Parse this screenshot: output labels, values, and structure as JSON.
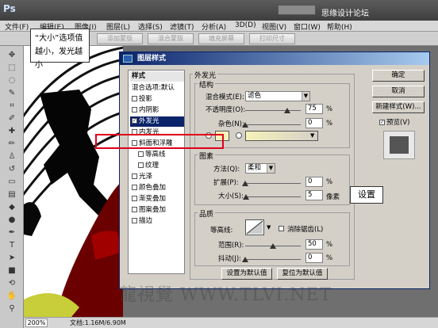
{
  "app": {
    "logo": "Ps"
  },
  "site_badge": "思缘设计论坛",
  "menu": [
    "文件(F)",
    "编辑(E)",
    "图像(I)",
    "图层(L)",
    "选择(S)",
    "滤镜(T)",
    "分析(A)",
    "3D(D)",
    "视图(V)",
    "窗口(W)",
    "帮助(H)"
  ],
  "options_bar": [
    "添加蒙版",
    "混合蒙版",
    "填充屏幕",
    "打印尺寸"
  ],
  "callout_top": {
    "line1": "“大小”选项值",
    "line2": "越小，发光越小"
  },
  "callout_set": "设置",
  "dialog": {
    "title": "图层样式",
    "close": "✕",
    "style_list_header": "样式",
    "style_list": [
      {
        "label": "混合选项:默认",
        "checkbox": false,
        "checked": false
      },
      {
        "label": "投影",
        "checkbox": true,
        "checked": false
      },
      {
        "label": "内阴影",
        "checkbox": true,
        "checked": false
      },
      {
        "label": "外发光",
        "checkbox": true,
        "checked": true,
        "selected": true
      },
      {
        "label": "内发光",
        "checkbox": true,
        "checked": false
      },
      {
        "label": "斜面和浮雕",
        "checkbox": true,
        "checked": false
      },
      {
        "label": "等高线",
        "checkbox": true,
        "checked": false,
        "indent": true
      },
      {
        "label": "纹理",
        "checkbox": true,
        "checked": false,
        "indent": true
      },
      {
        "label": "光泽",
        "checkbox": true,
        "checked": false
      },
      {
        "label": "颜色叠加",
        "checkbox": true,
        "checked": false
      },
      {
        "label": "渐变叠加",
        "checkbox": true,
        "checked": false
      },
      {
        "label": "图案叠加",
        "checkbox": true,
        "checked": false
      },
      {
        "label": "描边",
        "checkbox": true,
        "checked": false
      }
    ],
    "outer_glow_title": "外发光",
    "structure": {
      "title": "结构",
      "blend_mode_label": "混合模式(E):",
      "blend_mode_value": "滤色",
      "opacity_label": "不透明度(O):",
      "opacity_value": "75",
      "opacity": 0.75,
      "noise_label": "杂色(N):",
      "noise_value": "0",
      "noise": 0.0
    },
    "elements": {
      "title": "图素",
      "method_label": "方法(Q):",
      "method_value": "柔和",
      "spread_label": "扩展(P):",
      "spread_value": "0",
      "spread": 0.0,
      "size_label": "大小(S):",
      "size_value": "5",
      "size": 0.02,
      "size_unit": "像素"
    },
    "quality": {
      "title": "品质",
      "contour_label": "等高线:",
      "antialias_label": "消除锯齿(L)",
      "range_label": "范围(R):",
      "range_value": "50",
      "range": 0.5,
      "jitter_label": "抖动(J):",
      "jitter_value": "0",
      "jitter": 0.0
    },
    "percent": "%",
    "buttons": {
      "ok": "确定",
      "cancel": "取消",
      "new_style": "新建样式(W)...",
      "preview": "预览(V)",
      "make_default": "设置为默认值",
      "reset_default": "复位为默认值"
    }
  },
  "status": {
    "zoom": "200%",
    "doc": "文档:1.16M/6.90M"
  },
  "watermark": "龍視覺 WWW.TLVI.NET"
}
